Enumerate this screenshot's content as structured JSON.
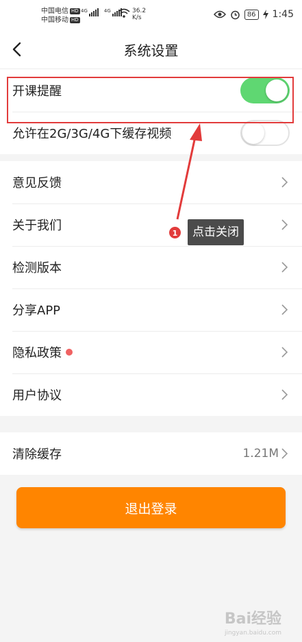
{
  "status_bar": {
    "carrier_1": "中国电信",
    "carrier_2": "中国移动",
    "hd_badge": "HD",
    "network_1": "4G",
    "network_2": "4G",
    "speed_value": "36.2",
    "speed_unit": "K/s",
    "battery": "86",
    "time": "1:45"
  },
  "header": {
    "title": "系统设置"
  },
  "toggles": [
    {
      "label": "开课提醒",
      "on": true
    },
    {
      "label": "允许在2G/3G/4G下缓存视频",
      "on": false
    }
  ],
  "menu": [
    {
      "label": "意见反馈"
    },
    {
      "label": "关于我们"
    },
    {
      "label": "检测版本"
    },
    {
      "label": "分享APP"
    },
    {
      "label": "隐私政策",
      "badge": true
    },
    {
      "label": "用户协议"
    }
  ],
  "cache": {
    "label": "清除缓存",
    "value": "1.21M"
  },
  "logout_label": "退出登录",
  "annotation": {
    "step": "1",
    "text": "点击关闭"
  },
  "watermark": {
    "text": "Bai经验",
    "url": "jingyan.baidu.com"
  },
  "colors": {
    "accent": "#ff8500",
    "toggle_on": "#5fd772",
    "highlight": "#e23b3b"
  }
}
